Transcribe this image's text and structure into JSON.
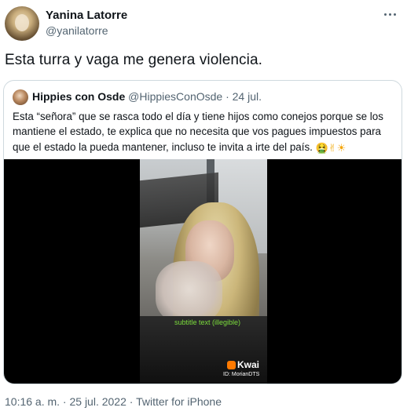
{
  "author": {
    "name": "Yanina Latorre",
    "handle": "@yanilatorre"
  },
  "tweet": {
    "text": "Esta turra y vaga me genera violencia."
  },
  "quoted": {
    "name": "Hippies con Osde",
    "handle": "@HippiesConOsde",
    "separator": "·",
    "date": "24 jul.",
    "text": "Esta “señora” que se rasca todo el día y tiene hijos como conejos porque se los mantiene el estado, te explica que no necesita que vos pagues impuestos para que el estado la pueda mantener, incluso te invita a irte del país.",
    "emojis": [
      "🤮",
      "✌",
      "☀"
    ],
    "video": {
      "caption": "subtitle text (illegible)",
      "watermark": "Kwai",
      "watermark_id": "ID: MorianDTS"
    }
  },
  "meta": {
    "timestamp": "10:16 a. m. · 25 jul. 2022 · Twitter for iPhone"
  },
  "icons": {
    "more": "more-horizontal-icon"
  }
}
